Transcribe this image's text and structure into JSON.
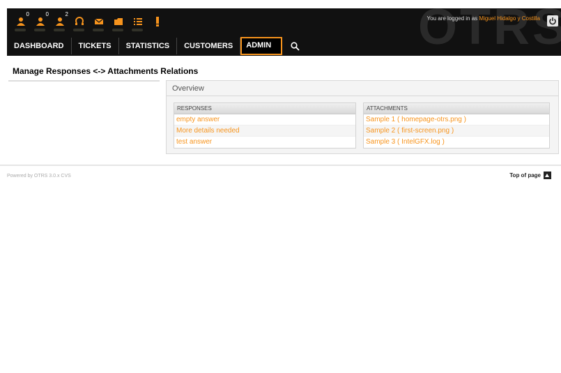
{
  "header": {
    "toolbar": [
      {
        "name": "locked-tickets-icon",
        "count": "0"
      },
      {
        "name": "watched-tickets-icon",
        "count": "0"
      },
      {
        "name": "responsible-tickets-icon",
        "count": "2"
      },
      {
        "name": "phone-ticket-icon",
        "count": ""
      },
      {
        "name": "email-ticket-icon",
        "count": ""
      },
      {
        "name": "queue-view-icon",
        "count": ""
      },
      {
        "name": "status-view-icon",
        "count": ""
      },
      {
        "name": "escalation-view-icon",
        "count": ""
      }
    ],
    "logo_text": "OTRS",
    "login_prefix": "You are logged in as",
    "login_user": "Miguel Hidalgo y Costilla"
  },
  "nav": {
    "items": [
      "DASHBOARD",
      "TICKETS",
      "STATISTICS",
      "CUSTOMERS",
      "ADMIN"
    ],
    "active": "ADMIN"
  },
  "page": {
    "title": "Manage Responses <-> Attachments Relations"
  },
  "overview": {
    "title": "Overview",
    "responses_header": "RESPONSES",
    "attachments_header": "ATTACHMENTS",
    "responses": [
      "empty answer",
      "More details needed",
      "test answer"
    ],
    "attachments": [
      "Sample 1 ( homepage-otrs.png )",
      "Sample 2 ( first-screen.png )",
      "Sample 3 ( IntelGFX.log )"
    ]
  },
  "footer": {
    "powered": "Powered by OTRS 3.0.x CVS",
    "top_of_page": "Top of page"
  },
  "colors": {
    "accent": "#f7941d",
    "header_bg": "#111111"
  }
}
